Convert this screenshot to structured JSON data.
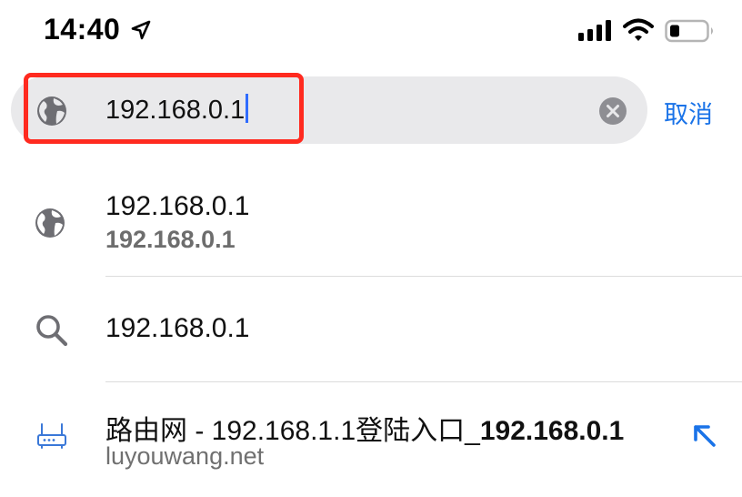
{
  "status_bar": {
    "time": "14:40",
    "icons": [
      "location-arrow-icon",
      "cellular-signal-icon",
      "wifi-icon",
      "battery-icon"
    ]
  },
  "search": {
    "value": "192.168.0.1",
    "cancel_label": "取消",
    "leading_icon": "globe-icon",
    "clear_icon": "clear-circle-icon"
  },
  "suggestions": [
    {
      "icon": "globe-icon",
      "title": "192.168.0.1",
      "subtitle": "192.168.0.1"
    },
    {
      "icon": "search-icon",
      "title": "192.168.0.1"
    },
    {
      "icon": "router-icon",
      "title_prefix": "路由网 - 192.168.1.1登陆入口_",
      "title_bold": "192.168.0.1",
      "subtitle": "luyouwang.net",
      "action_icon": "fill-arrow-icon"
    }
  ],
  "colors": {
    "accent": "#1a73e8",
    "highlight": "#ff2a1f",
    "field_bg": "#e9e9eb"
  }
}
